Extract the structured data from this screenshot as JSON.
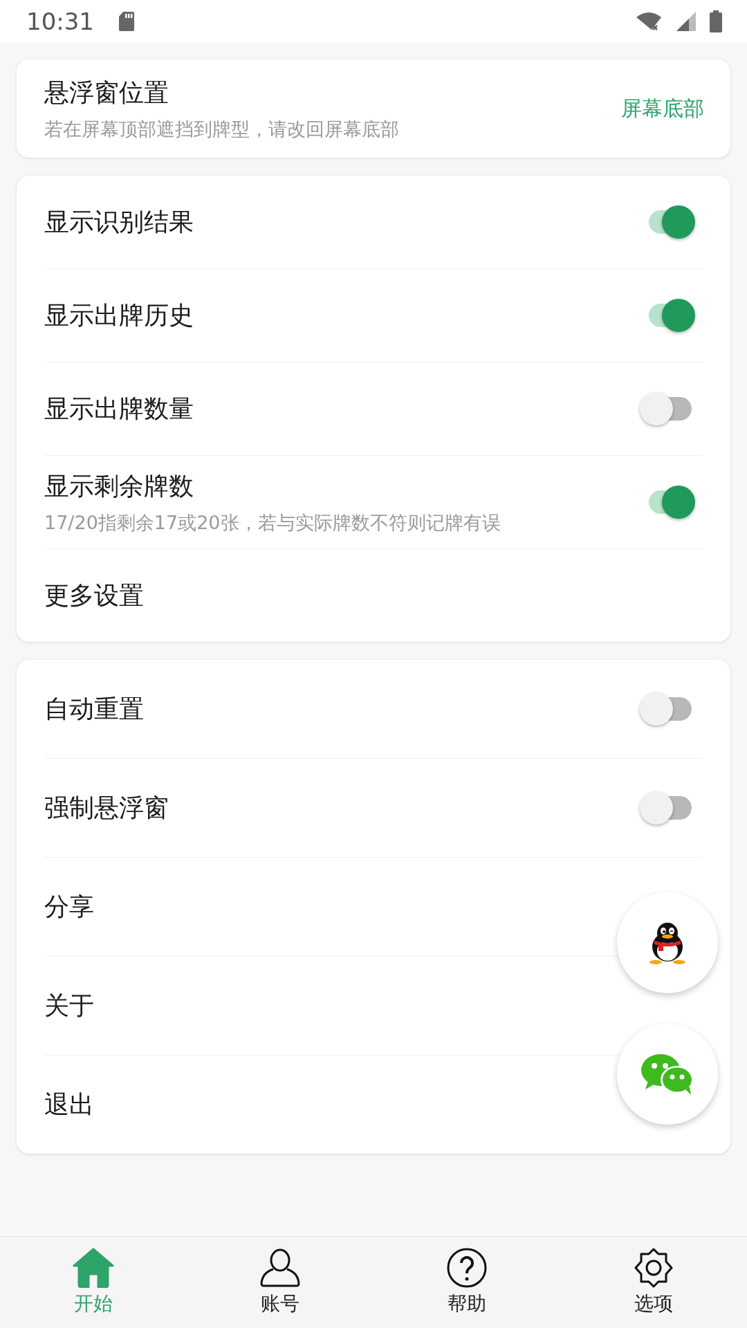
{
  "status_bar": {
    "time": "10:31"
  },
  "position_card": {
    "title": "悬浮窗位置",
    "subtitle": "若在屏幕顶部遮挡到牌型，请改回屏幕底部",
    "value": "屏幕底部"
  },
  "display_settings": [
    {
      "kind": "toggle",
      "label": "显示识别结果",
      "on": true
    },
    {
      "kind": "toggle",
      "label": "显示出牌历史",
      "on": true
    },
    {
      "kind": "toggle",
      "label": "显示出牌数量",
      "on": false
    },
    {
      "kind": "toggle",
      "label": "显示剩余牌数",
      "subtitle": "17/20指剩余17或20张，若与实际牌数不符则记牌有误",
      "on": true
    },
    {
      "kind": "link",
      "label": "更多设置"
    }
  ],
  "other_settings": [
    {
      "kind": "toggle",
      "label": "自动重置",
      "on": false
    },
    {
      "kind": "toggle",
      "label": "强制悬浮窗",
      "on": false
    },
    {
      "kind": "link",
      "label": "分享"
    },
    {
      "kind": "link",
      "label": "关于"
    },
    {
      "kind": "link",
      "label": "退出"
    }
  ],
  "bottom_nav": [
    {
      "label": "开始",
      "selected": true
    },
    {
      "label": "账号",
      "selected": false
    },
    {
      "label": "帮助",
      "selected": false
    },
    {
      "label": "选项",
      "selected": false
    }
  ]
}
